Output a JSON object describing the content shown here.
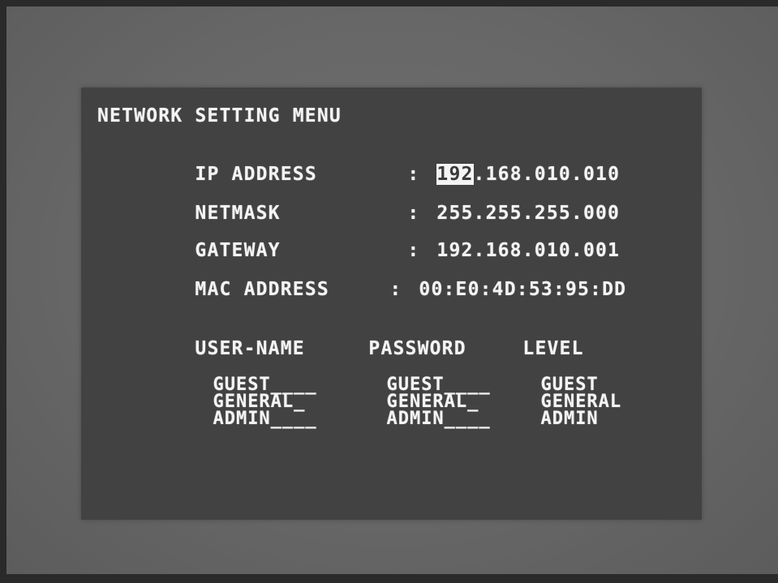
{
  "osd": {
    "title": "NETWORK SETTING MENU",
    "fields": [
      {
        "label": "IP ADDRESS",
        "sep": ":",
        "value_selected": "192",
        "value_rest": ".168.010.010"
      },
      {
        "label": "NETMASK",
        "sep": ":",
        "value": "255.255.255.000"
      },
      {
        "label": "GATEWAY",
        "sep": ":",
        "value": "192.168.010.001"
      },
      {
        "label": "MAC ADDRESS",
        "sep": ":",
        "value": "00:E0:4D:53:95:DD"
      }
    ],
    "users": {
      "headers": {
        "username": "USER-NAME",
        "password": "PASSWORD",
        "level": "LEVEL"
      },
      "rows": [
        {
          "username": "GUEST____",
          "password": "GUEST____",
          "level": "GUEST"
        },
        {
          "username": "GENERAL_",
          "password": "GENERAL_",
          "level": "GENERAL"
        },
        {
          "username": "ADMIN____",
          "password": "ADMIN____",
          "level": "ADMIN"
        }
      ]
    }
  }
}
